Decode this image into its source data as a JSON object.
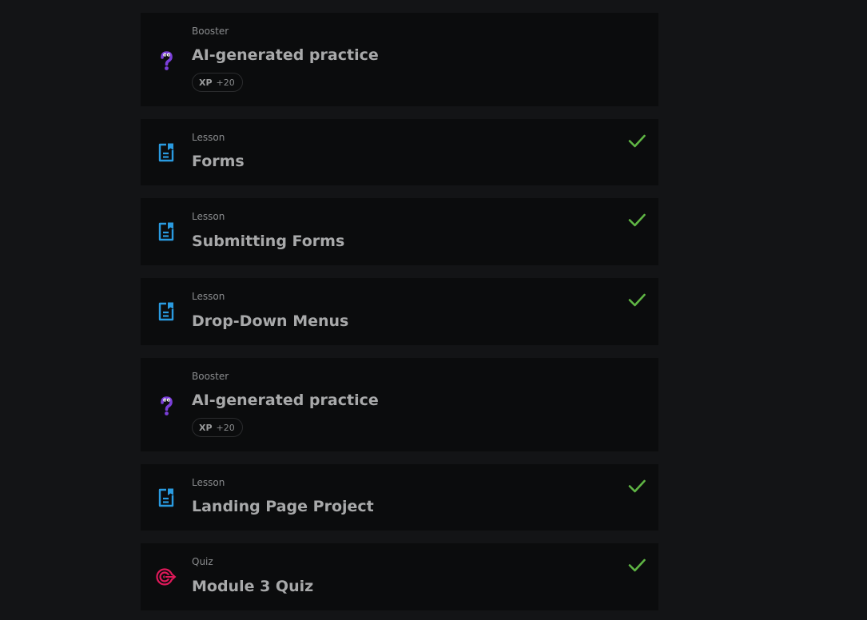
{
  "items": [
    {
      "type": "Booster",
      "title": "AI-generated practice",
      "xp_label": "XP",
      "xp_value": "+20",
      "icon": "booster-question-icon",
      "completed": false
    },
    {
      "type": "Lesson",
      "title": "Forms",
      "icon": "lesson-document-icon",
      "completed": true
    },
    {
      "type": "Lesson",
      "title": "Submitting Forms",
      "icon": "lesson-document-icon",
      "completed": true
    },
    {
      "type": "Lesson",
      "title": "Drop-Down Menus",
      "icon": "lesson-document-icon",
      "completed": true
    },
    {
      "type": "Booster",
      "title": "AI-generated practice",
      "xp_label": "XP",
      "xp_value": "+20",
      "icon": "booster-question-icon",
      "completed": false
    },
    {
      "type": "Lesson",
      "title": "Landing Page Project",
      "icon": "lesson-document-icon",
      "completed": true
    },
    {
      "type": "Quiz",
      "title": "Module 3 Quiz",
      "icon": "quiz-target-icon",
      "completed": true
    }
  ],
  "colors": {
    "background": "#131416",
    "card": "#0b0c0d",
    "lesson_icon": "#2a9be0",
    "booster_icon": "#7b3fd9",
    "quiz_icon": "#e0195a",
    "check": "#5fb544"
  }
}
